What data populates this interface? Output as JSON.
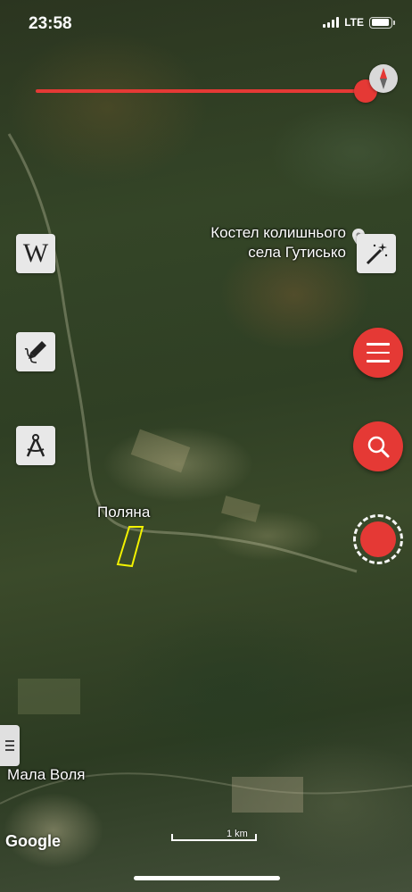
{
  "status_bar": {
    "time": "23:58",
    "network": "LTE",
    "battery_level": 0.95
  },
  "map": {
    "type": "satellite",
    "poi": {
      "label_line1": "Костел колишнього",
      "label_line2": "села Гутисько",
      "icon": "location-pin-icon"
    },
    "places": [
      {
        "name": "Поляна"
      },
      {
        "name": "Мала Воля"
      }
    ],
    "scale": "1 km",
    "attribution": "Google",
    "highlight_color": "#f2f200"
  },
  "controls": {
    "accent_color": "#e53935",
    "left_tools": [
      {
        "name": "wikipedia",
        "icon": "wikipedia-icon"
      },
      {
        "name": "draw",
        "icon": "pen-draw-icon"
      },
      {
        "name": "measure",
        "icon": "compass-measure-icon"
      }
    ],
    "right_tools": [
      {
        "name": "magic-wand",
        "icon": "magic-wand-icon"
      },
      {
        "name": "menu",
        "icon": "hamburger-icon"
      },
      {
        "name": "search",
        "icon": "search-icon"
      },
      {
        "name": "record",
        "icon": "record-icon"
      }
    ],
    "wiki_glyph": "W"
  }
}
